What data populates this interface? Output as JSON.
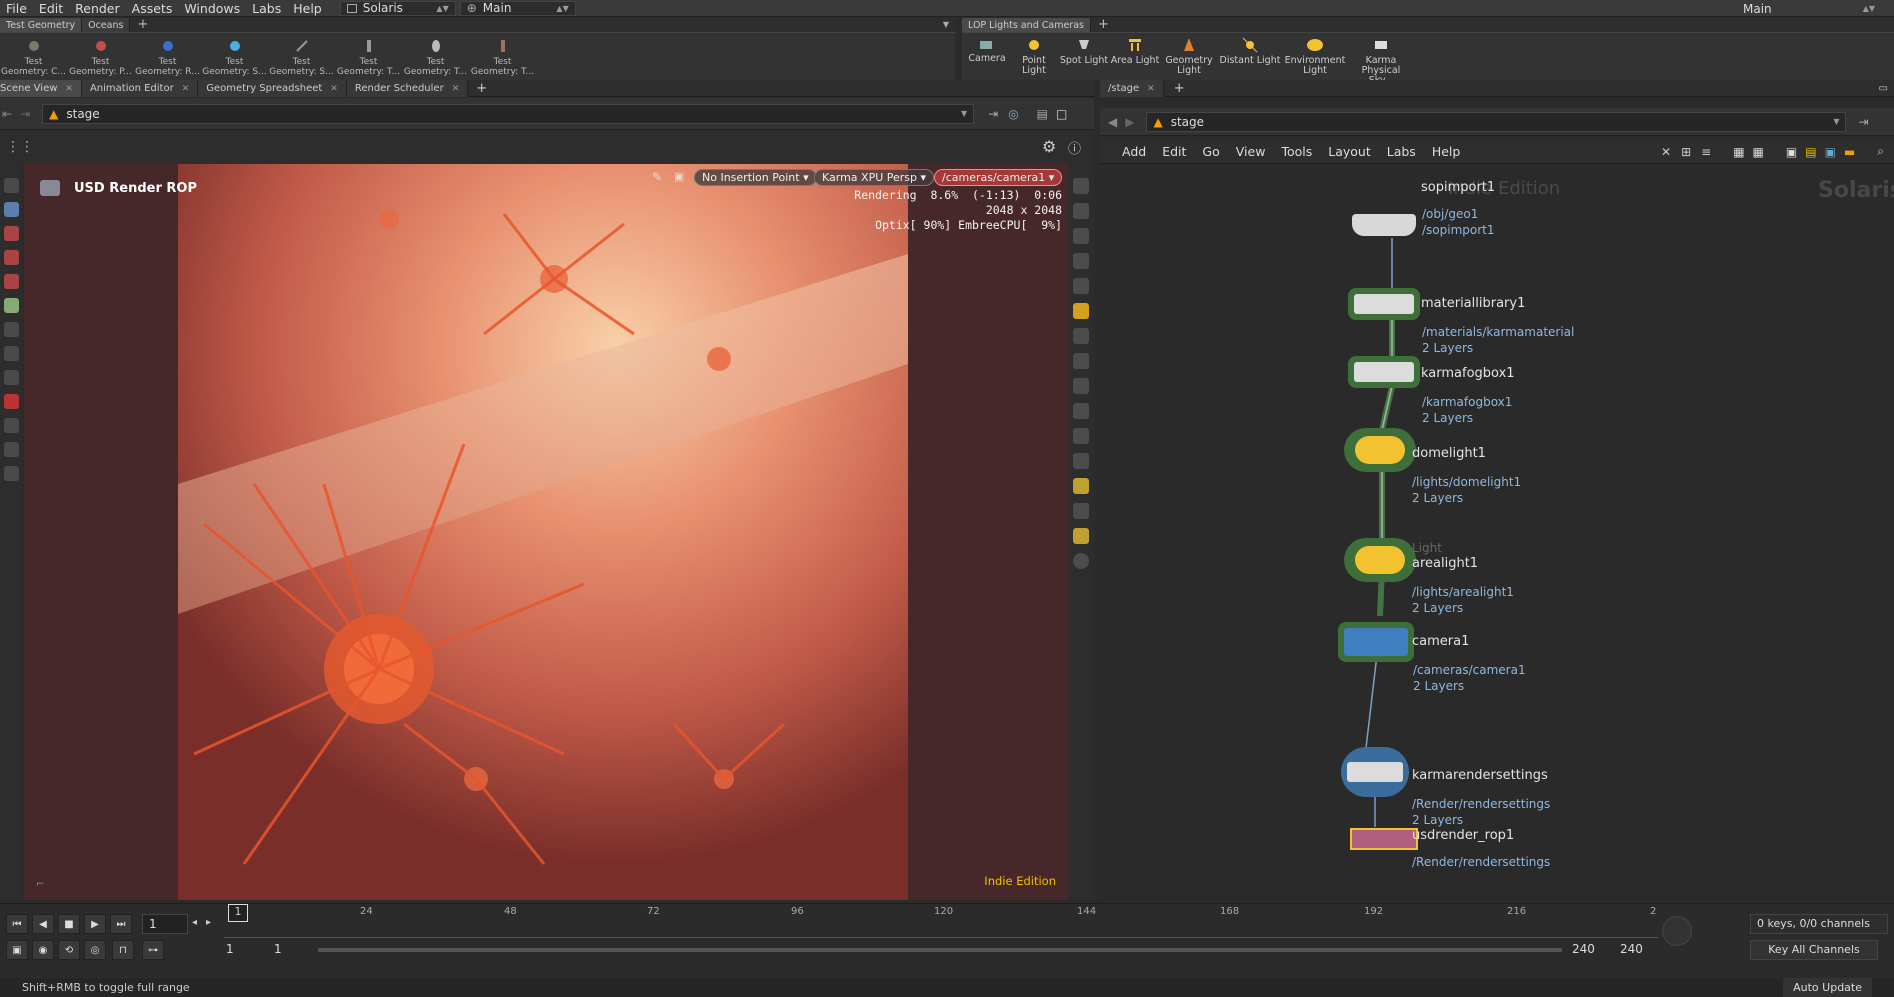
{
  "menubar": {
    "items": [
      "File",
      "Edit",
      "Render",
      "Assets",
      "Windows",
      "Labs",
      "Help"
    ],
    "desktop": "Solaris",
    "context": "Main",
    "right_desktop": "Main"
  },
  "left_shelf": {
    "tabs": [
      "Test Geometry",
      "Oceans"
    ],
    "tools": [
      "Test Geometry: C...",
      "Test Geometry: P...",
      "Test Geometry: R...",
      "Test Geometry: S...",
      "Test Geometry: S...",
      "Test Geometry: T...",
      "Test Geometry: T...",
      "Test Geometry: T..."
    ]
  },
  "right_shelf": {
    "tabs": [
      "LOP Lights and Cameras"
    ],
    "tools": [
      "Camera",
      "Point Light",
      "Spot Light",
      "Area Light",
      "Geometry Light",
      "Distant Light",
      "Environment Light",
      "Karma Physical Sky..."
    ]
  },
  "left_pane": {
    "tabs": [
      "Scene View",
      "Animation Editor",
      "Geometry Spreadsheet",
      "Render Scheduler"
    ],
    "path": "stage"
  },
  "viewport": {
    "rop_title": "USD Render ROP",
    "insertion": "No Insertion Point",
    "renderer": "Karma XPU",
    "view": "Persp",
    "camera": "/cameras/camera1",
    "status_line1": "Rendering  8.6%  (-1:13)  0:06",
    "status_line2": "2048 x 2048",
    "status_line3": "Optix[ 90%] EmbreeCPU[  9%]",
    "watermark": "Indie Edition"
  },
  "network": {
    "tab": "/stage",
    "path": "stage",
    "menu": [
      "Add",
      "Edit",
      "Go",
      "View",
      "Tools",
      "Layout",
      "Labs",
      "Help"
    ],
    "watermark": "Indie Edition",
    "context_label": "Solaris",
    "nodes": [
      {
        "name": "sopimport1",
        "sub1": "/obj/geo1",
        "sub2": "/sopimport1"
      },
      {
        "name": "materiallibrary1",
        "sub1": "/materials/karmamaterial",
        "sub2": "2 Layers"
      },
      {
        "name": "karmafogbox1",
        "sub1": "/karmafogbox1",
        "sub2": "2 Layers"
      },
      {
        "name": "domelight1",
        "sub1": "/lights/domelight1",
        "sub2": "2 Layers"
      },
      {
        "name": "arealight1",
        "sub1": "/lights/arealight1",
        "sub2": "2 Layers",
        "tag": "Light"
      },
      {
        "name": "camera1",
        "sub1": "/cameras/camera1",
        "sub2": "2 Layers"
      },
      {
        "name": "karmarendersettings",
        "sub1": "/Render/rendersettings",
        "sub2": "2 Layers"
      },
      {
        "name": "usdrender_rop1",
        "sub1": "/Render/rendersettings",
        "sub2": ""
      }
    ]
  },
  "timeline": {
    "current_frame": "1",
    "marker_frame": "1",
    "ticks": [
      "24",
      "48",
      "72",
      "96",
      "120",
      "144",
      "168",
      "192",
      "216",
      "2"
    ],
    "range_start": "1",
    "range_start2": "1",
    "range_end": "240",
    "range_end2": "240",
    "keys_info": "0 keys, 0/0 channels",
    "key_all": "Key All Channels",
    "auto_update": "Auto Update"
  },
  "status": "Shift+RMB to toggle full range",
  "colors": {
    "accent": "#f0a000",
    "node_green": "#3e6e3a",
    "link": "#8fb8e0"
  }
}
